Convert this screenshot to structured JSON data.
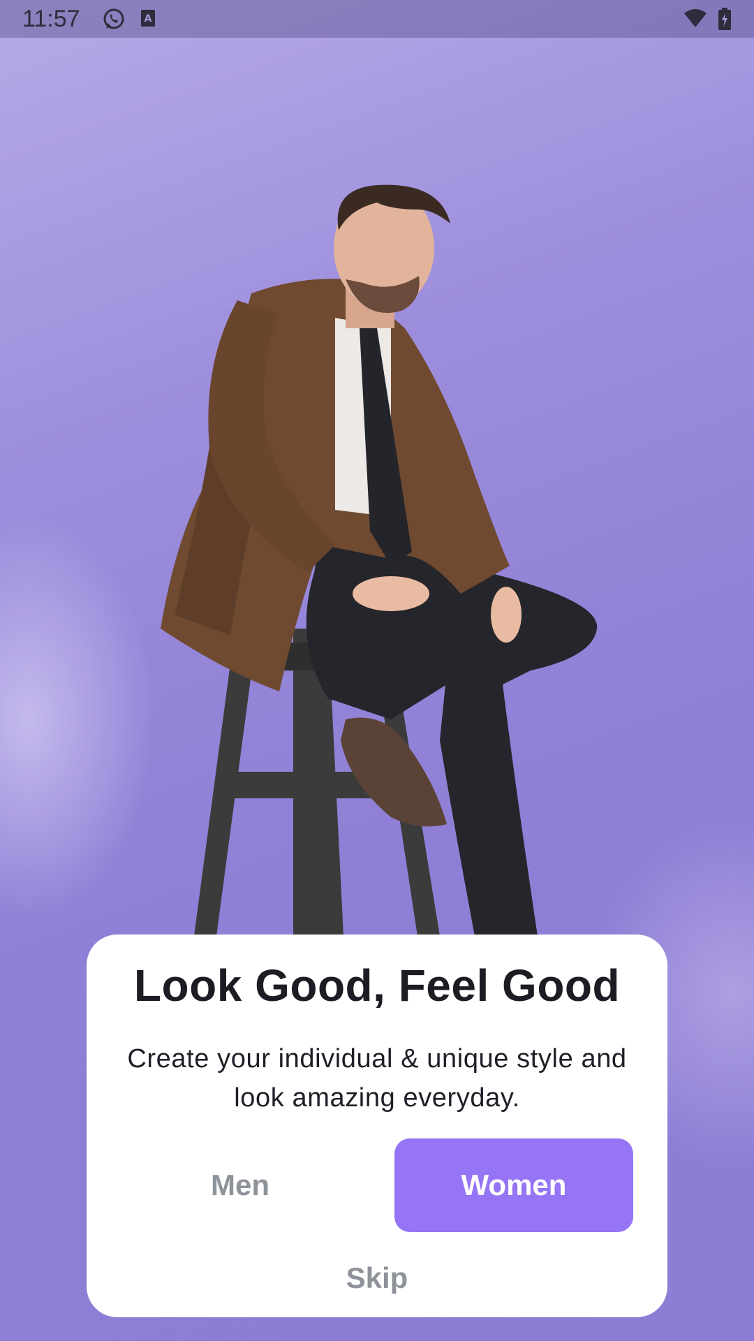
{
  "status_bar": {
    "time": "11:57",
    "icons": [
      "whatsapp-icon",
      "a-badge-icon",
      "wifi-icon",
      "battery-charging-icon"
    ]
  },
  "hero": {
    "illustration": "man-on-stool-illustration",
    "colors": {
      "background": "#9386d6",
      "coat": "#6e4a32",
      "trousers": "#25272c",
      "stool": "#3a3a3a"
    }
  },
  "onboarding": {
    "title": "Look Good, Feel Good",
    "subtitle_line1": "Create your individual & unique style and",
    "subtitle_line2": "look amazing everyday.",
    "men_label": "Men",
    "women_label": "Women",
    "skip_label": "Skip",
    "selected": "Women",
    "accent_color": "#9575f5"
  }
}
